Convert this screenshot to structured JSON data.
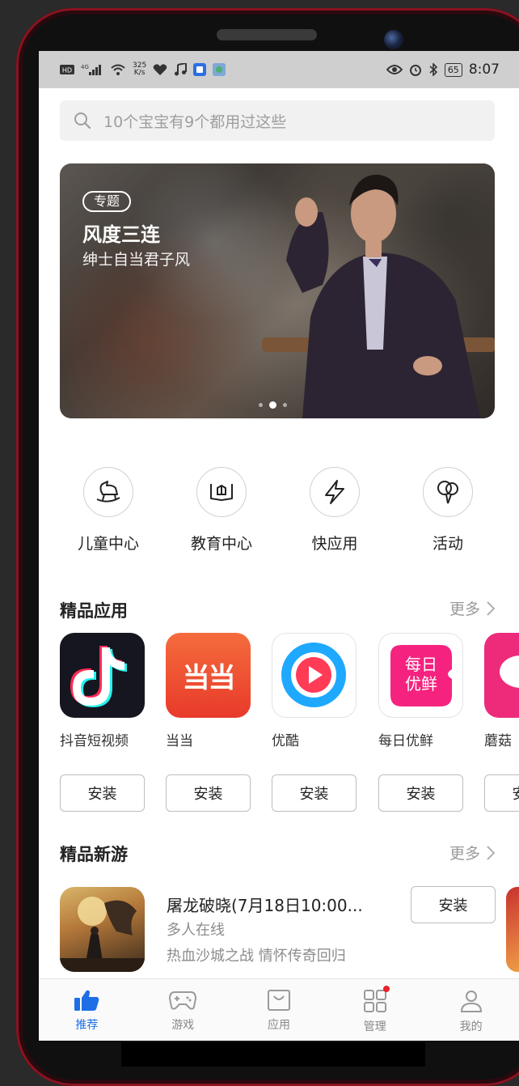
{
  "status_bar": {
    "left_icons": [
      "hd-icon",
      "4g-signal-icon",
      "wifi-icon",
      "heart-icon",
      "music-icon",
      "app-icon"
    ],
    "net_speed_value": "325",
    "net_speed_unit": "K/s",
    "right_icons": [
      "eye-icon",
      "alarm-icon",
      "bluetooth-icon"
    ],
    "battery": "65",
    "time": "8:07"
  },
  "search": {
    "placeholder": "10个宝宝有9个都用过这些"
  },
  "banner": {
    "tag": "专题",
    "title": "风度三连",
    "subtitle": "绅士自当君子风",
    "dots": 3,
    "active_dot": 1
  },
  "quick_links": [
    {
      "label": "儿童中心",
      "icon": "rocking-horse-icon"
    },
    {
      "label": "教育中心",
      "icon": "book-icon"
    },
    {
      "label": "快应用",
      "icon": "lightning-icon"
    },
    {
      "label": "活动",
      "icon": "balloon-icon"
    }
  ],
  "featured_apps": {
    "title": "精品应用",
    "more": "更多",
    "install_label": "安装",
    "apps": [
      {
        "name": "抖音短视频",
        "icon": "douyin-icon"
      },
      {
        "name": "当当",
        "icon": "dangdang-icon"
      },
      {
        "name": "优酷",
        "icon": "youku-icon"
      },
      {
        "name": "每日优鲜",
        "icon": "missfresh-icon"
      },
      {
        "name": "蘑菇",
        "icon": "mogu-icon"
      }
    ],
    "dangdang_logo": "当当",
    "missfresh_logo_top": "每日",
    "missfresh_logo_bottom": "优鲜"
  },
  "new_games": {
    "title": "精品新游",
    "more": "更多",
    "game": {
      "title": "屠龙破晓(7月18日10:00...",
      "subtitle1": "多人在线",
      "subtitle2": "热血沙城之战 情怀传奇回归",
      "install_label": "安装"
    }
  },
  "bottom_nav": {
    "items": [
      {
        "label": "推荐",
        "icon": "thumbs-up-icon",
        "active": true
      },
      {
        "label": "游戏",
        "icon": "gamepad-icon",
        "active": false
      },
      {
        "label": "应用",
        "icon": "shopping-bag-icon",
        "active": false
      },
      {
        "label": "管理",
        "icon": "grid-icon",
        "active": false,
        "badge": true
      },
      {
        "label": "我的",
        "icon": "user-icon",
        "active": false
      }
    ]
  },
  "colors": {
    "accent": "#1e6fe6",
    "badge": "#e8222a",
    "frame": "#8a1320"
  }
}
